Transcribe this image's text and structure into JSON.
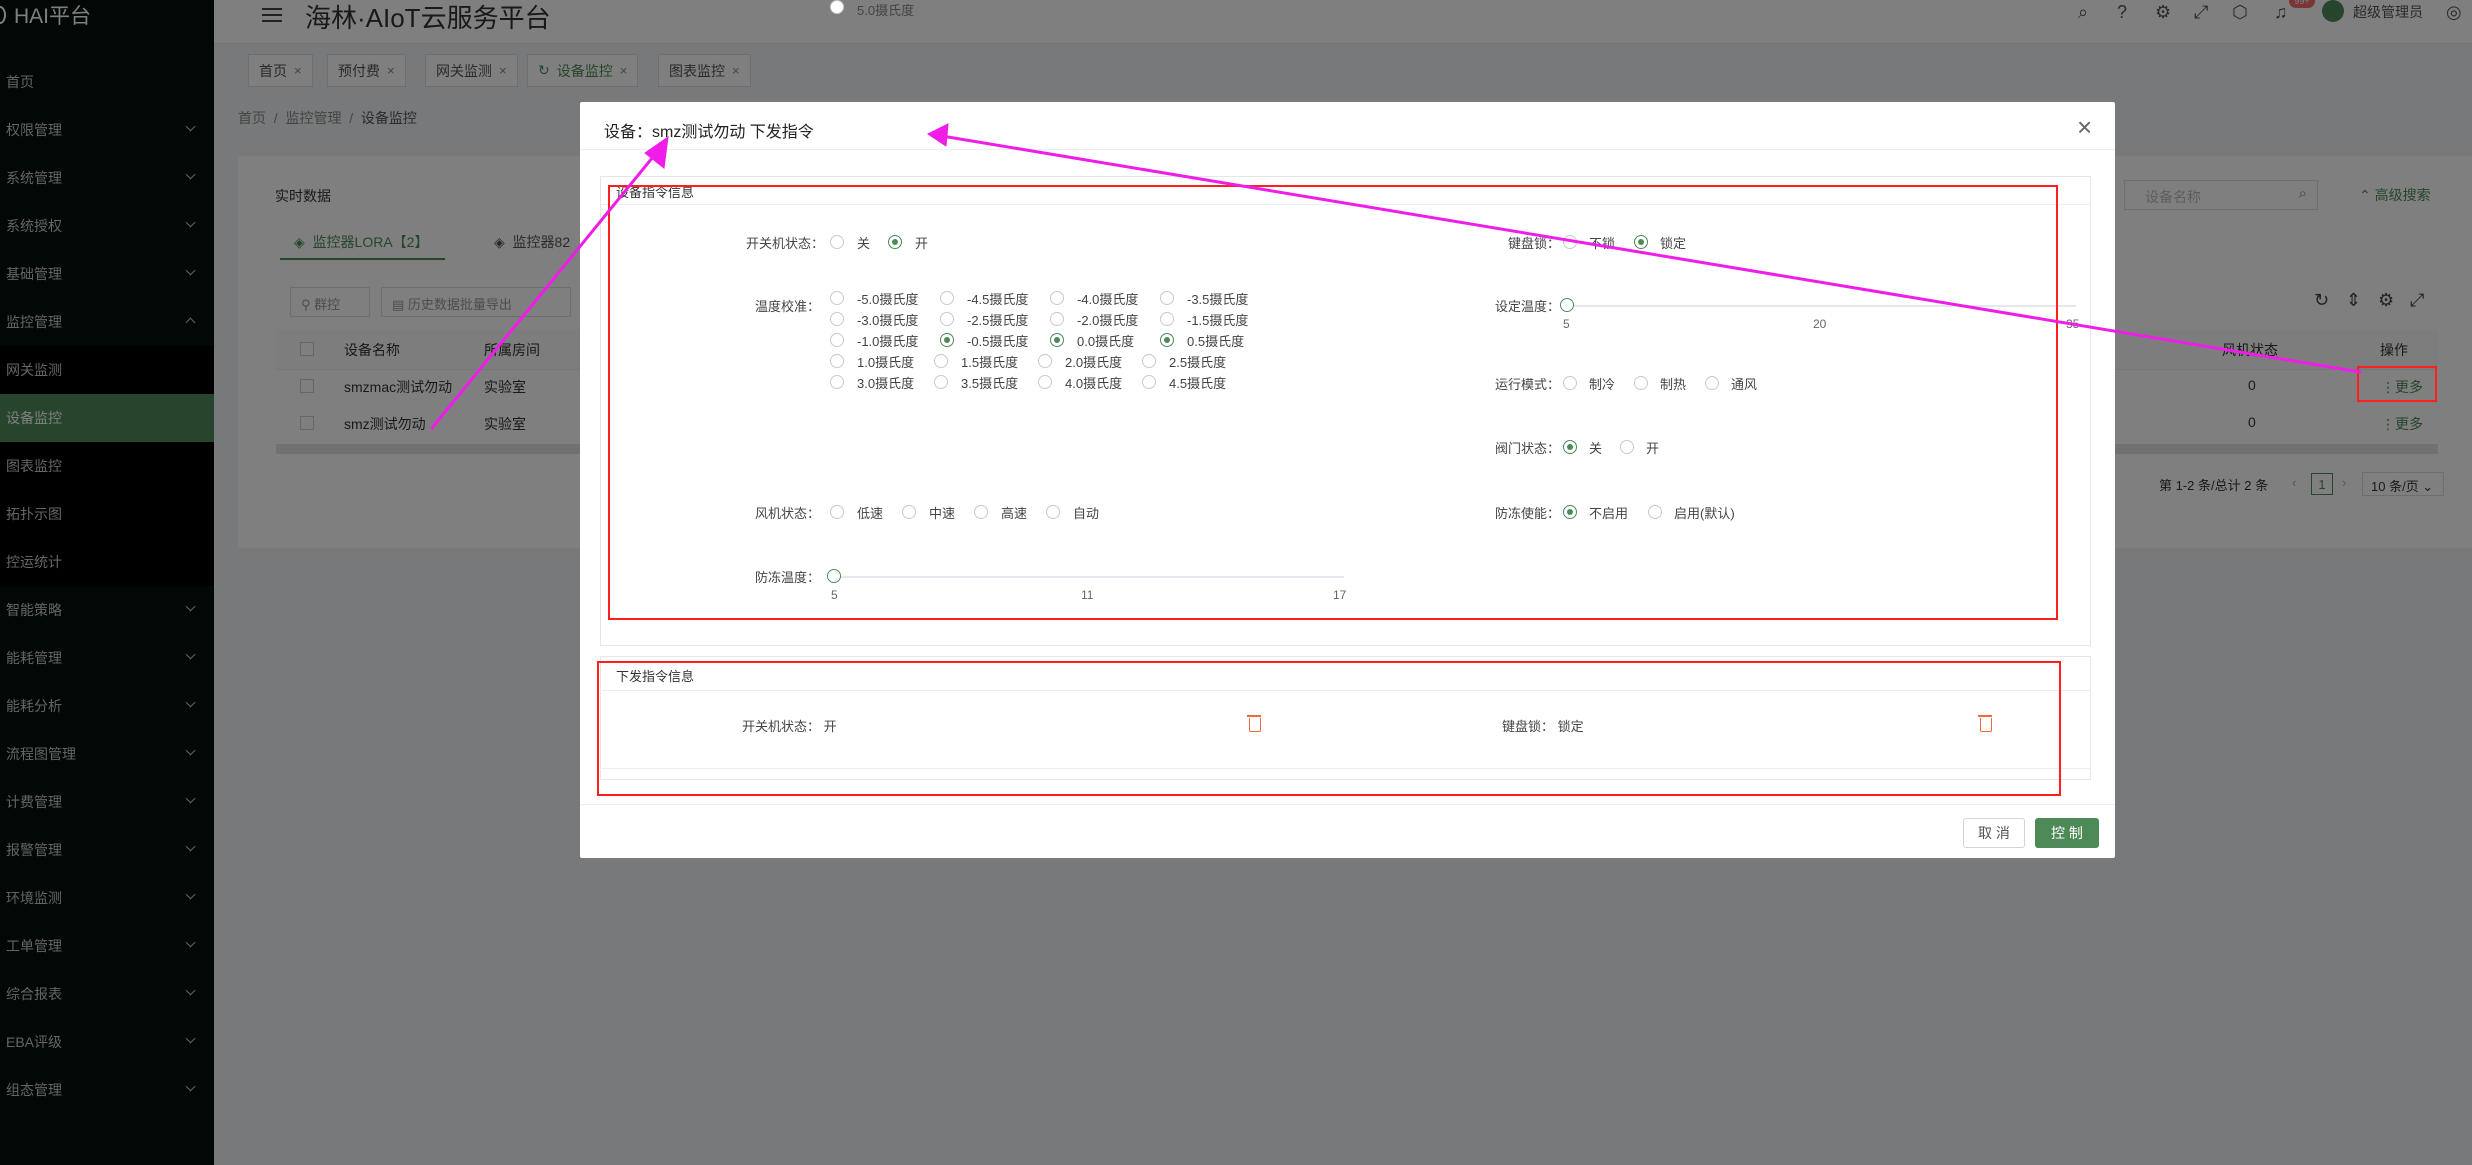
{
  "app": {
    "brand": "HAI平台",
    "title": "海林·AIoT云服务平台"
  },
  "header": {
    "user": "超级管理员",
    "badge": "99+"
  },
  "sidebar": {
    "items": [
      {
        "label": "首页"
      },
      {
        "label": "权限管理"
      },
      {
        "label": "系统管理"
      },
      {
        "label": "系统授权"
      },
      {
        "label": "基础管理"
      },
      {
        "label": "监控管理"
      },
      {
        "label": "网关监测"
      },
      {
        "label": "设备监控"
      },
      {
        "label": "图表监控"
      },
      {
        "label": "拓扑示图"
      },
      {
        "label": "控运统计"
      },
      {
        "label": "智能策略"
      },
      {
        "label": "能耗管理"
      },
      {
        "label": "能耗分析"
      },
      {
        "label": "流程图管理"
      },
      {
        "label": "计费管理"
      },
      {
        "label": "报警管理"
      },
      {
        "label": "环境监测"
      },
      {
        "label": "工单管理"
      },
      {
        "label": "综合报表"
      },
      {
        "label": "EBA评级"
      },
      {
        "label": "组态管理"
      }
    ]
  },
  "tabs": [
    {
      "label": "首页"
    },
    {
      "label": "预付费"
    },
    {
      "label": "网关监测"
    },
    {
      "label": "设备监控"
    },
    {
      "label": "图表监控"
    }
  ],
  "breadcrumb": [
    "首页",
    "监控管理",
    "设备监控"
  ],
  "page": {
    "card_title": "实时数据",
    "subtabs": [
      "监控器LORA【2】",
      "监控器82"
    ],
    "buttons": [
      "群控",
      "历史数据批量导出"
    ],
    "search_placeholder": "设备名称",
    "advanced": "高级搜索",
    "columns": [
      "设备名称",
      "所属房间",
      "风机状态",
      "操作"
    ],
    "rows": [
      {
        "name": "smzmac测试勿动",
        "room": "实验室",
        "fan": "0",
        "op": "更多"
      },
      {
        "name": "smz测试勿动",
        "room": "实验室",
        "fan": "0",
        "op": "更多"
      }
    ],
    "pagination": {
      "summary": "第 1-2 条/总计 2 条",
      "page": "1",
      "size": "10 条/页"
    }
  },
  "modal": {
    "title": "设备：smz测试勿动 下发指令",
    "section1": "设备指令信息",
    "section2": "下发指令信息",
    "power": {
      "label": "开关机状态：",
      "options": [
        "关",
        "开"
      ],
      "selected": 1
    },
    "keylock": {
      "label": "键盘锁：",
      "options": [
        "不锁",
        "锁定"
      ],
      "selected": 1
    },
    "calibration": {
      "label": "温度校准：",
      "options": [
        "-5.0摄氏度",
        "-4.5摄氏度",
        "-4.0摄氏度",
        "-3.5摄氏度",
        "-3.0摄氏度",
        "-2.5摄氏度",
        "-2.0摄氏度",
        "-1.5摄氏度",
        "-1.0摄氏度",
        "-0.5摄氏度",
        "0.0摄氏度",
        "0.5摄氏度",
        "1.0摄氏度",
        "1.5摄氏度",
        "2.0摄氏度",
        "2.5摄氏度",
        "3.0摄氏度",
        "3.5摄氏度",
        "4.0摄氏度",
        "4.5摄氏度",
        "5.0摄氏度"
      ],
      "checked": [
        9,
        10,
        11
      ]
    },
    "settemp": {
      "label": "设定温度：",
      "ticks": [
        "5",
        "20",
        "35"
      ],
      "value": 5
    },
    "mode": {
      "label": "运行模式：",
      "options": [
        "制冷",
        "制热",
        "通风"
      ]
    },
    "valve": {
      "label": "阀门状态：",
      "options": [
        "关",
        "开"
      ],
      "selected": 0
    },
    "fan": {
      "label": "风机状态：",
      "options": [
        "低速",
        "中速",
        "高速",
        "自动"
      ]
    },
    "antifreeze_enable": {
      "label": "防冻使能：",
      "options": [
        "不启用",
        "启用(默认)"
      ],
      "selected": 0
    },
    "antifreeze_temp": {
      "label": "防冻温度：",
      "ticks": [
        "5",
        "11",
        "17"
      ],
      "value": 5
    },
    "issued": [
      {
        "label": "开关机状态：",
        "value": "开"
      },
      {
        "label": "键盘锁：",
        "value": "锁定"
      }
    ],
    "cancel": "取 消",
    "submit": "控 制"
  },
  "colors": {
    "accent": "#4e8a58",
    "sidebar": "#04100a",
    "highlight": "#ff1f1f",
    "arrow": "#f01ce8"
  }
}
